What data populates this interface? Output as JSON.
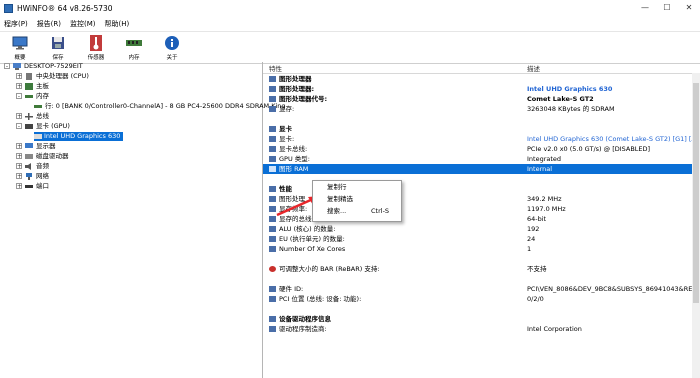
{
  "window": {
    "title": "HWiNFO® 64 v8.26-5730",
    "controls": [
      "—",
      "☐",
      "✕"
    ]
  },
  "menu": [
    "程序(P)",
    "报告(R)",
    "监控(M)",
    "帮助(H)"
  ],
  "toolbar": [
    {
      "label": "概要",
      "icon": "monitor-icon"
    },
    {
      "label": "保存",
      "icon": "floppy-icon"
    },
    {
      "label": "传感器",
      "icon": "thermometer-icon"
    },
    {
      "label": "内存",
      "icon": "memory-icon"
    },
    {
      "label": "关于",
      "icon": "info-icon"
    }
  ],
  "tree": {
    "root": "DESKTOP-7529EIT",
    "items": [
      {
        "label": "中央处理器 (CPU)",
        "expander": "+"
      },
      {
        "label": "主板",
        "expander": "+"
      },
      {
        "label": "内存",
        "expander": "-"
      },
      {
        "label": "行: 0 [BANK 0/Controller0-ChannelA] - 8 GB PC4-25600 DDR4 SDRAM King",
        "expander": ""
      },
      {
        "label": "总线",
        "expander": "+"
      },
      {
        "label": "显卡 (GPU)",
        "expander": "-"
      },
      {
        "label": "Intel UHD Graphics 630",
        "expander": "",
        "selected": true
      },
      {
        "label": "显示器",
        "expander": "+"
      },
      {
        "label": "磁盘驱动器",
        "expander": "+"
      },
      {
        "label": "音频",
        "expander": "+"
      },
      {
        "label": "网络",
        "expander": "+"
      },
      {
        "label": "端口",
        "expander": "+"
      }
    ]
  },
  "details": {
    "col_feature": "特性",
    "col_desc": "描述",
    "rows": [
      {
        "k": "图形处理器",
        "v": "",
        "sec": true
      },
      {
        "k": "图形处理器:",
        "v": "Intel UHD Graphics 630",
        "bold": true,
        "blue": true
      },
      {
        "k": "图形处理器代号:",
        "v": "Comet Lake-S GT2",
        "bold": true
      },
      {
        "k": "显存:",
        "v": "3263048 KBytes 的 SDRAM"
      },
      {
        "k": "",
        "v": ""
      },
      {
        "k": "显卡",
        "v": "",
        "sec": true
      },
      {
        "k": "显卡:",
        "v": "Intel UHD Graphics 630 (Comet Lake-S GT2) [G1] [AS",
        "blue": true
      },
      {
        "k": "显卡总线:",
        "v": "PCIe v2.0 x0 (5.0 GT/s) @ [DISABLED]"
      },
      {
        "k": "GPU 类型:",
        "v": "Integrated"
      },
      {
        "k": "图形 RAM",
        "v": "Internal",
        "sel": true
      },
      {
        "k": "",
        "v": ""
      },
      {
        "k": "性能",
        "v": "",
        "sec": true
      },
      {
        "k": "图形处理",
        "v": "349.2 MHz"
      },
      {
        "k": "显存频率:",
        "v": "1197.0 MHz"
      },
      {
        "k": "显存的总线位宽:",
        "v": "64-bit"
      },
      {
        "k": "ALU (核心) 的数量:",
        "v": "192"
      },
      {
        "k": "EU (执行单元) 的数量:",
        "v": "24"
      },
      {
        "k": "Number Of Xe Cores",
        "v": "1"
      },
      {
        "k": "",
        "v": ""
      },
      {
        "k": "可调整大小的 BAR (ReBAR) 支持:",
        "v": "不支持"
      },
      {
        "k": "",
        "v": ""
      },
      {
        "k": "硬件 ID:",
        "v": "PCI\\VEN_8086&DEV_9BC8&SUBSYS_86941043&REV_03"
      },
      {
        "k": "PCI 位置 (总线: 设备: 功能):",
        "v": "0/2/0"
      },
      {
        "k": "",
        "v": ""
      },
      {
        "k": "设备驱动程序信息",
        "v": "",
        "sec": true
      },
      {
        "k": "驱动程序制造商:",
        "v": "Intel Corporation"
      }
    ]
  },
  "context_menu": {
    "items": [
      {
        "label": "复制行",
        "shortcut": ""
      },
      {
        "label": "复制精选",
        "shortcut": ""
      },
      {
        "label": "搜索...",
        "shortcut": "Ctrl-S"
      }
    ]
  },
  "colors": {
    "selection": "#0a6fd6",
    "link_blue": "#1f63d3",
    "annotation_arrow": "#e8262a"
  }
}
